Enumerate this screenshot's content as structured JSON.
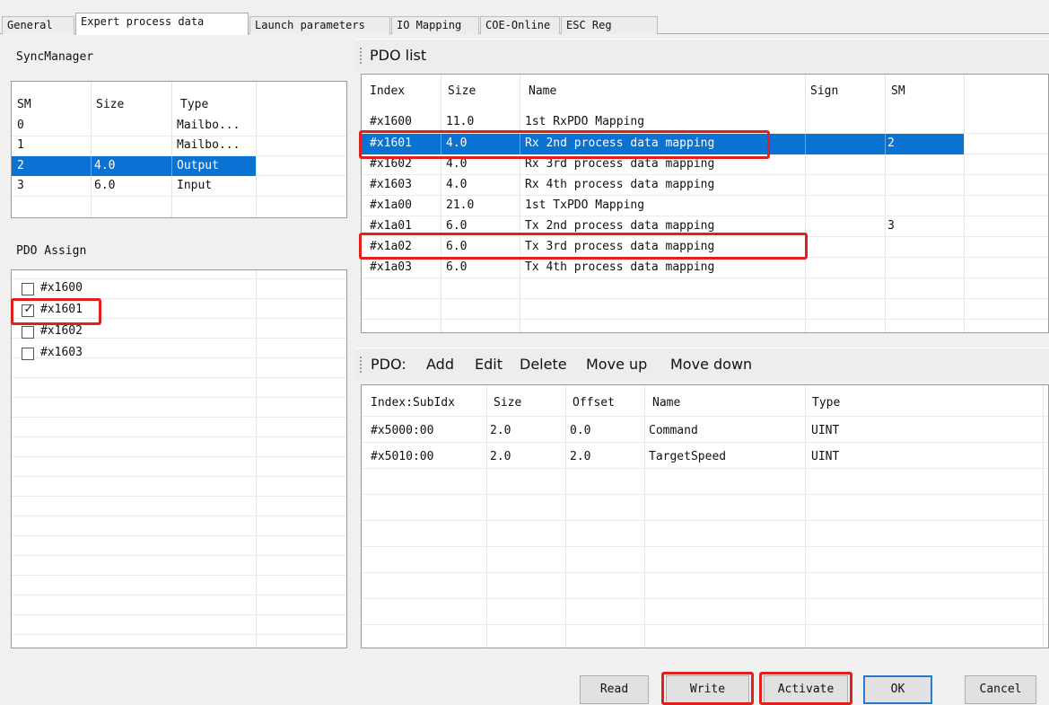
{
  "tabs": [
    "General",
    "Expert process data",
    "Launch parameters",
    "IO Mapping",
    "COE-Online",
    "ESC Reg"
  ],
  "active_tab": "Expert process data",
  "sync_manager": {
    "title": "SyncManager",
    "columns": [
      "SM",
      "Size",
      "Type"
    ],
    "rows": [
      {
        "sm": "0",
        "size": "",
        "type": "Mailbo..."
      },
      {
        "sm": "1",
        "size": "",
        "type": "Mailbo..."
      },
      {
        "sm": "2",
        "size": "4.0",
        "type": "Output"
      },
      {
        "sm": "3",
        "size": "6.0",
        "type": "Input"
      }
    ],
    "selected_row": 2
  },
  "pdo_assign": {
    "title": "PDO Assign",
    "items": [
      {
        "label": "#x1600",
        "checked": false
      },
      {
        "label": "#x1601",
        "checked": true
      },
      {
        "label": "#x1602",
        "checked": false
      },
      {
        "label": "#x1603",
        "checked": false
      }
    ]
  },
  "pdo_list": {
    "title": "PDO list",
    "columns": [
      "Index",
      "Size",
      "Name",
      "Sign",
      "SM"
    ],
    "rows": [
      {
        "index": "#x1600",
        "size": "11.0",
        "name": "1st RxPDO Mapping",
        "sign": "",
        "sm": ""
      },
      {
        "index": "#x1601",
        "size": "4.0",
        "name": "Rx 2nd process data mapping",
        "sign": "",
        "sm": "2"
      },
      {
        "index": "#x1602",
        "size": "4.0",
        "name": "Rx 3rd process data mapping",
        "sign": "",
        "sm": ""
      },
      {
        "index": "#x1603",
        "size": "4.0",
        "name": "Rx 4th process data mapping",
        "sign": "",
        "sm": ""
      },
      {
        "index": "#x1a00",
        "size": "21.0",
        "name": "1st TxPDO Mapping",
        "sign": "",
        "sm": ""
      },
      {
        "index": "#x1a01",
        "size": "6.0",
        "name": "Tx 2nd process data mapping",
        "sign": "",
        "sm": "3"
      },
      {
        "index": "#x1a02",
        "size": "6.0",
        "name": "Tx 3rd process data mapping",
        "sign": "",
        "sm": ""
      },
      {
        "index": "#x1a03",
        "size": "6.0",
        "name": "Tx 4th process data mapping",
        "sign": "",
        "sm": ""
      }
    ],
    "selected_row": 1
  },
  "pdo_toolbar": {
    "label": "PDO:",
    "add": "Add",
    "edit": "Edit",
    "delete": "Delete",
    "move_up": "Move up",
    "move_down": "Move down"
  },
  "pdo_entries": {
    "columns": [
      "Index:SubIdx",
      "Size",
      "Offset",
      "Name",
      "Type"
    ],
    "rows": [
      {
        "index": "#x5000:00",
        "size": "2.0",
        "offset": "0.0",
        "name": "Command",
        "type": "UINT"
      },
      {
        "index": "#x5010:00",
        "size": "2.0",
        "offset": "2.0",
        "name": "TargetSpeed",
        "type": "UINT"
      }
    ]
  },
  "buttons": {
    "read": "Read",
    "write": "Write",
    "activate": "Activate",
    "ok": "OK",
    "cancel": "Cancel"
  },
  "colors": {
    "selection": "#0a72d2",
    "highlight_box": "#e0201b",
    "default_button_border": "#2a79d0"
  }
}
